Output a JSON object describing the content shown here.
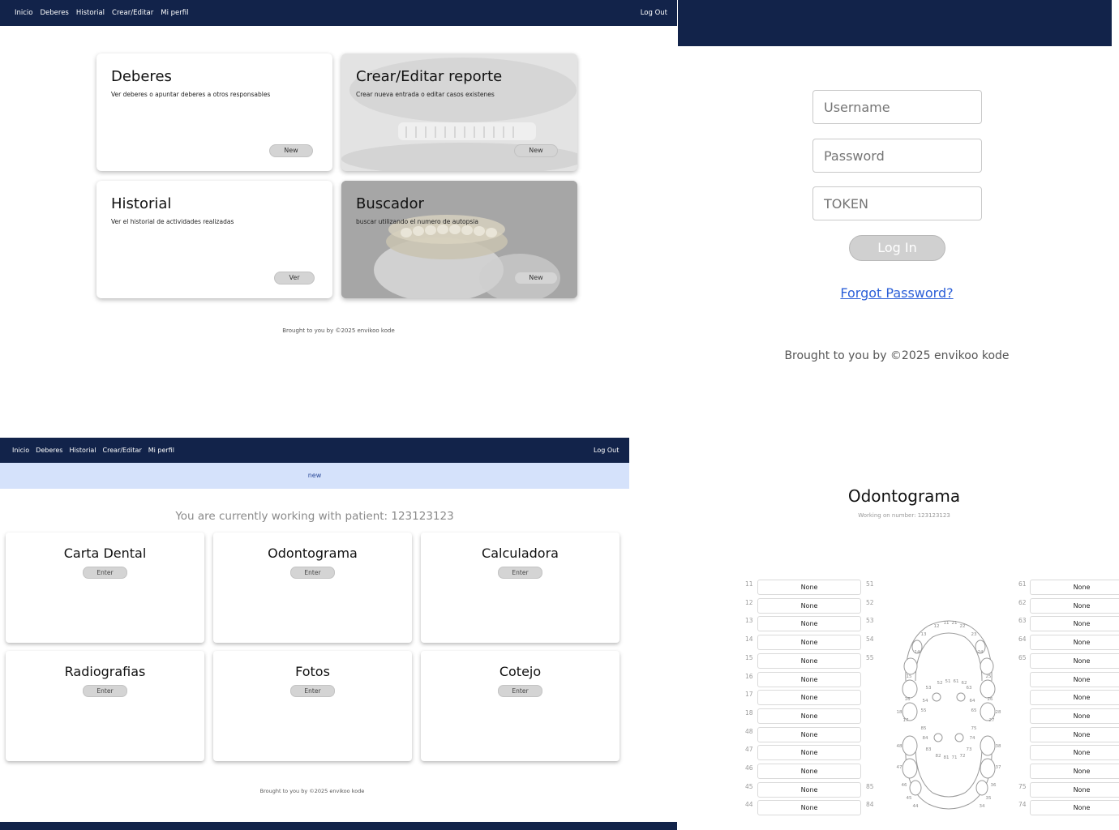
{
  "nav": {
    "items": [
      "Inicio",
      "Deberes",
      "Historial",
      "Crear/Editar",
      "Mi perfil"
    ],
    "logout": "Log Out"
  },
  "dashboard": {
    "cards": [
      {
        "title": "Deberes",
        "desc": "Ver deberes o apuntar deberes a otros responsables",
        "button": "New"
      },
      {
        "title": "Crear/Editar reporte",
        "desc": "Crear nueva entrada o editar casos existenes",
        "button": "New"
      },
      {
        "title": "Historial",
        "desc": "Ver el historial de actividades realizadas",
        "button": "Ver"
      },
      {
        "title": "Buscador",
        "desc": "buscar utilizando el numero de autopsia",
        "button": "New"
      }
    ],
    "footer": "Brought to you by ©2025 envikoo kode"
  },
  "login": {
    "username_placeholder": "Username",
    "password_placeholder": "Password",
    "token_placeholder": "TOKEN",
    "login_button": "Log In",
    "forgot_link": "Forgot Password?",
    "footer": "Brought to you by ©2025 envikoo kode"
  },
  "patient": {
    "alert": "new",
    "working_text": "You are currently working with patient: 123123123",
    "cards": [
      {
        "title": "Carta Dental",
        "button": "Enter"
      },
      {
        "title": "Odontograma",
        "button": "Enter"
      },
      {
        "title": "Calculadora",
        "button": "Enter"
      },
      {
        "title": "Radiografias",
        "button": "Enter"
      },
      {
        "title": "Fotos",
        "button": "Enter"
      },
      {
        "title": "Cotejo",
        "button": "Enter"
      }
    ],
    "footer": "Brought to you by ©2025 envikoo kode"
  },
  "odontograma": {
    "title": "Odontograma",
    "subtitle": "Working on number: 123123123",
    "left_numbers": [
      "11",
      "12",
      "13",
      "14",
      "15",
      "16",
      "17",
      "18",
      "48",
      "47",
      "46",
      "45",
      "44"
    ],
    "left_values": [
      "None",
      "None",
      "None",
      "None",
      "None",
      "None",
      "None",
      "None",
      "None",
      "None",
      "None",
      "None",
      "None"
    ],
    "mid_numbers": [
      "51",
      "52",
      "53",
      "54",
      "55",
      "",
      "",
      "",
      "",
      "",
      "",
      "85",
      "84"
    ],
    "right_numbers": [
      "61",
      "62",
      "63",
      "64",
      "65",
      "",
      "",
      "",
      "",
      "",
      "",
      "75",
      "74"
    ],
    "right_values": [
      "None",
      "None",
      "None",
      "None",
      "None",
      "None",
      "None",
      "None",
      "None",
      "None",
      "None",
      "None",
      "None"
    ],
    "chart_labels": {
      "upper": [
        "12",
        "11",
        "21",
        "22",
        "13",
        "23",
        "14",
        "24",
        "15",
        "25",
        "16",
        "26",
        "17",
        "27",
        "18",
        "28"
      ],
      "upper_primary": [
        "53",
        "52",
        "51",
        "61",
        "62",
        "63",
        "54",
        "64",
        "55",
        "65"
      ],
      "lower_primary": [
        "85",
        "75",
        "84",
        "74",
        "83",
        "73",
        "82",
        "81",
        "71",
        "72"
      ],
      "lower": [
        "48",
        "38",
        "47",
        "37",
        "46",
        "36",
        "45",
        "35",
        "44",
        "34"
      ]
    }
  }
}
